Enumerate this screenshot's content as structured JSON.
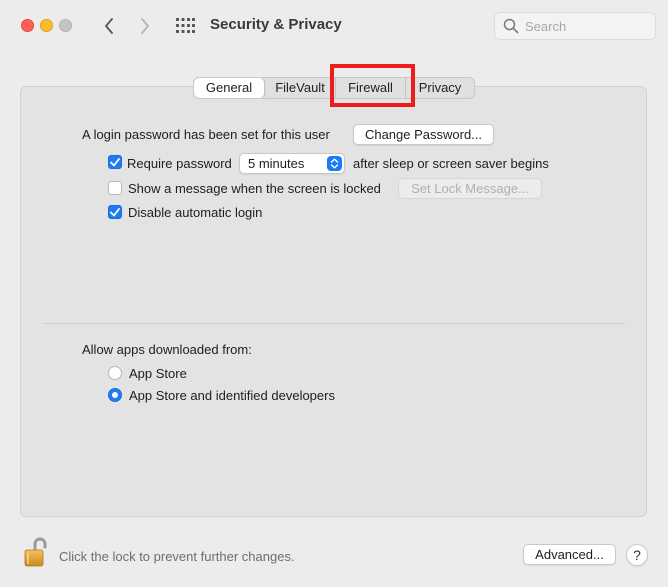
{
  "window": {
    "title": "Security & Privacy",
    "search_placeholder": "Search"
  },
  "tabs": [
    {
      "label": "General",
      "active": true
    },
    {
      "label": "FileVault",
      "active": false
    },
    {
      "label": "Firewall",
      "active": false,
      "highlighted": true
    },
    {
      "label": "Privacy",
      "active": false
    }
  ],
  "general": {
    "login_password_text": "A login password has been set for this user",
    "change_password_button": "Change Password...",
    "require_password": {
      "label": "Require password",
      "checked": true
    },
    "require_password_delay": "5 minutes",
    "after_sleep_text": "after sleep or screen saver begins",
    "show_message": {
      "label": "Show a message when the screen is locked",
      "checked": false
    },
    "set_lock_message_button": "Set Lock Message...",
    "disable_auto_login": {
      "label": "Disable automatic login",
      "checked": true
    }
  },
  "allow_apps": {
    "heading": "Allow apps downloaded from:",
    "options": [
      {
        "label": "App Store",
        "selected": false
      },
      {
        "label": "App Store and identified developers",
        "selected": true
      }
    ]
  },
  "footer": {
    "lock_text": "Click the lock to prevent further changes.",
    "advanced_button": "Advanced...",
    "help_label": "?"
  },
  "colors": {
    "accent": "#1c7cf7",
    "highlight_box": "#ee1c1c"
  }
}
